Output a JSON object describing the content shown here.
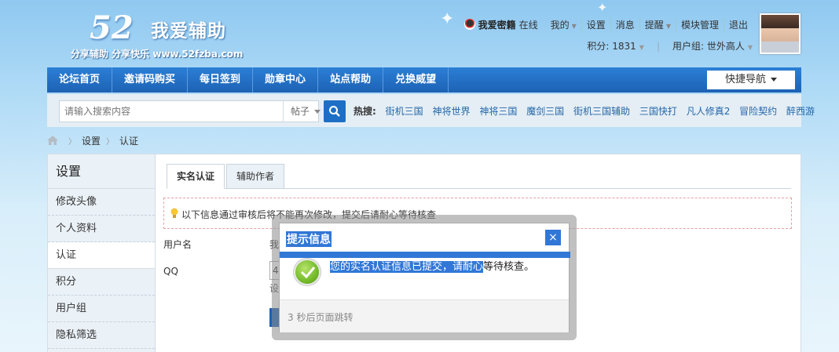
{
  "site": {
    "logo_number": "52",
    "logo_name": "我爱辅助",
    "slogan": "分享辅助  分享快乐  www.52fzba.com"
  },
  "topbar": {
    "username": "我爱密籍",
    "status": "在线",
    "links": [
      "我的",
      "设置",
      "消息",
      "提醒",
      "模块管理",
      "退出"
    ],
    "points": "积分: 1831",
    "usergroup": "用户组: 世外高人"
  },
  "nav": {
    "items": [
      "论坛首页",
      "邀请码购买",
      "每日签到",
      "勋章中心",
      "站点帮助",
      "兑换威望"
    ],
    "quick_nav": "快捷导航"
  },
  "search": {
    "placeholder": "请输入搜索内容",
    "type": "帖子",
    "hot_label": "热搜:",
    "hot_terms": [
      "街机三国",
      "神将世界",
      "神将三国",
      "魔剑三国",
      "街机三国辅助",
      "三国快打",
      "凡人修真2",
      "冒险契约",
      "醉西游"
    ]
  },
  "breadcrumb": [
    "设置",
    "认证"
  ],
  "sidebar": {
    "title": "设置",
    "items": [
      "修改头像",
      "个人资料",
      "认证",
      "积分",
      "用户组",
      "隐私筛选"
    ]
  },
  "main": {
    "tabs": [
      "实名认证",
      "辅助作者"
    ],
    "notice": "以下信息通过审核后将不能再次修改，提交后请耐心等待核查",
    "label_username": "用户名",
    "val_username": "我",
    "label_qq": "QQ",
    "val_qq": "4",
    "qq_hint": "设"
  },
  "dialog": {
    "title": "提示信息",
    "close": "×",
    "message_highlighted": "您的实名认证信息已提交，请耐心",
    "message_rest": "等待核查。",
    "footer": "3 秒后页面跳转"
  }
}
